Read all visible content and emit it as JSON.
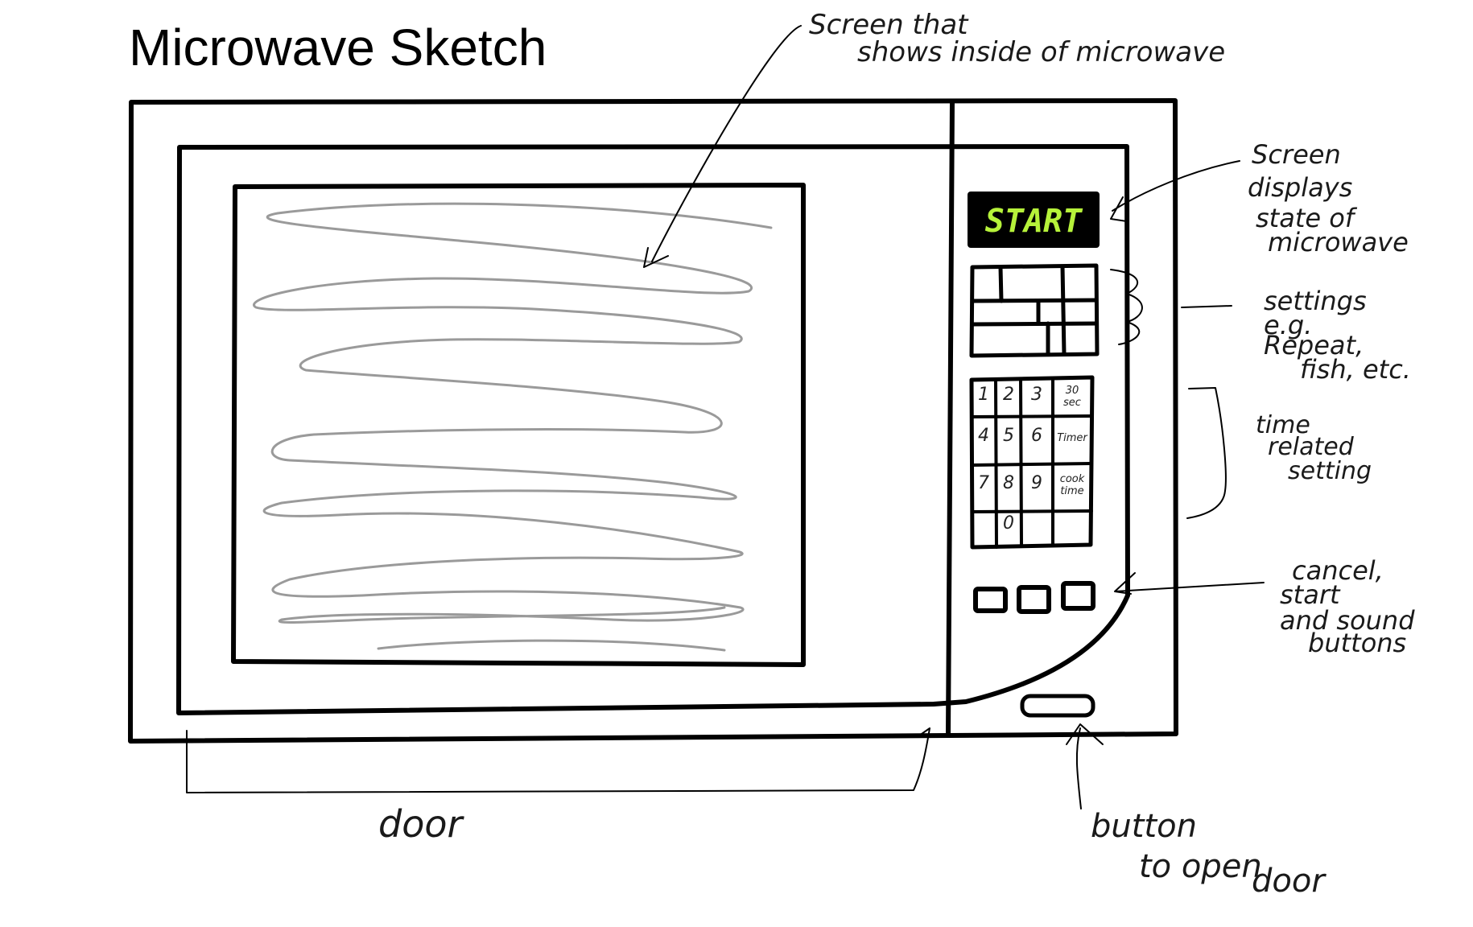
{
  "title": "Microwave Sketch",
  "display_text": "START",
  "colors": {
    "ink": "#000000",
    "display_background": "#000000",
    "display_text": "#b6f23a",
    "scribble": "#9a9a9a"
  },
  "keypad": {
    "keys": [
      "1",
      "2",
      "3",
      "30 sec",
      "4",
      "5",
      "6",
      "Timer",
      "7",
      "8",
      "9",
      "cook time",
      "",
      "0",
      "",
      ""
    ]
  },
  "annotations": {
    "window": [
      "Screen that",
      "shows inside of microwave"
    ],
    "display": [
      "Screen",
      "displays",
      "state of",
      "microwave"
    ],
    "settings": [
      "settings",
      "e.g.",
      "Repeat,",
      "fish, etc."
    ],
    "time": [
      "time",
      "related",
      "setting"
    ],
    "buttons": [
      "cancel,",
      "start",
      "and sound",
      "buttons"
    ],
    "door": [
      "door"
    ],
    "open_button": [
      "button",
      "to open",
      "door"
    ]
  }
}
